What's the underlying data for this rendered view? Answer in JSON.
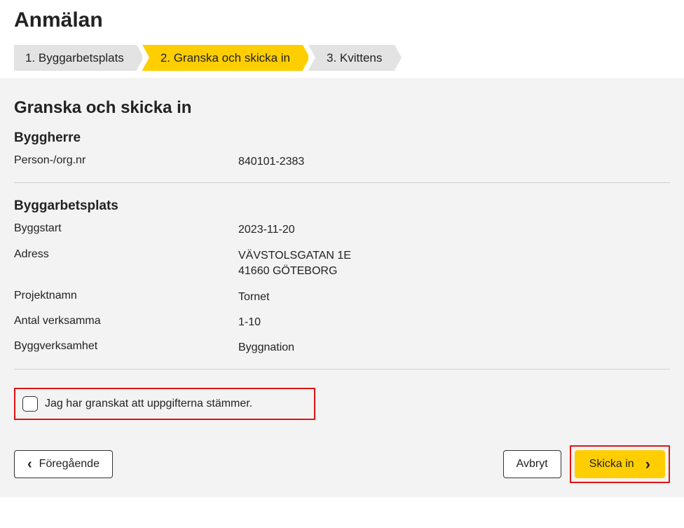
{
  "title": "Anmälan",
  "steps": {
    "s1": "1. Byggarbetsplats",
    "s2": "2. Granska och skicka in",
    "s3": "3. Kvittens"
  },
  "content": {
    "heading": "Granska och skicka in",
    "section1": {
      "title": "Byggherre",
      "rows": {
        "persorg_label": "Person-/org.nr",
        "persorg_value": "840101-2383"
      }
    },
    "section2": {
      "title": "Byggarbetsplats",
      "rows": {
        "byggstart_label": "Byggstart",
        "byggstart_value": "2023-11-20",
        "adress_label": "Adress",
        "adress_value": "VÄVSTOLSGATAN 1E\n41660 GÖTEBORG",
        "projektnamn_label": "Projektnamn",
        "projektnamn_value": "Tornet",
        "antal_label": "Antal verksamma",
        "antal_value": "1-10",
        "verksamhet_label": "Byggverksamhet",
        "verksamhet_value": "Byggnation"
      }
    },
    "confirm_label": "Jag har granskat att uppgifterna stämmer."
  },
  "buttons": {
    "prev": "Föregående",
    "cancel": "Avbryt",
    "submit": "Skicka in"
  },
  "colors": {
    "accent": "#ffce00",
    "highlight_border": "#e11313"
  }
}
